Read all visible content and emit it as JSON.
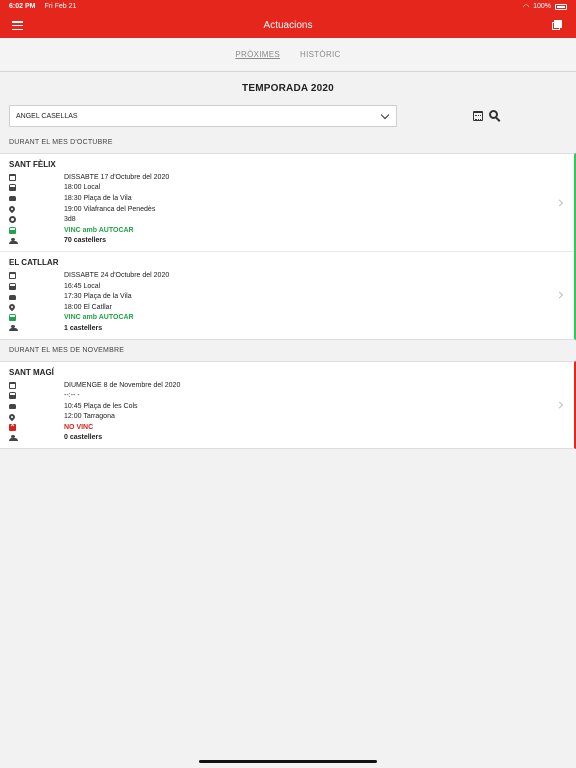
{
  "status_bar": {
    "time": "6:02 PM",
    "date": "Fri Feb 21",
    "battery": "100%"
  },
  "header": {
    "title": "Actuacions"
  },
  "tabs": [
    {
      "label": "PRÒXIMES",
      "active": true
    },
    {
      "label": "HISTÒRIC",
      "active": false
    }
  ],
  "season_title": "TEMPORADA 2020",
  "person_select": {
    "value": "ANGEL CASELLAS"
  },
  "colors": {
    "brand": "#e5261c",
    "attending": "#21a34a",
    "not_attending": "#d8221b"
  },
  "months": [
    {
      "label": "DURANT EL MES D'OCTUBRE",
      "status_color": "green",
      "events": [
        {
          "name": "SANT FÈLIX",
          "rows": [
            {
              "icon": "calendar-icon",
              "text": "DISSABTE 17 d'Octubre del 2020",
              "style": ""
            },
            {
              "icon": "bus-icon",
              "text": "18:00 Local",
              "style": ""
            },
            {
              "icon": "car-icon",
              "text": "18:30 Plaça de la Vila",
              "style": ""
            },
            {
              "icon": "map-pin-icon",
              "text": "19:00 Vilafranca del Penedès",
              "style": ""
            },
            {
              "icon": "castell-icon",
              "text": "3d8",
              "style": ""
            },
            {
              "icon": "bus-green-icon",
              "text": "VINC amb AUTOCAR",
              "style": "ok"
            },
            {
              "icon": "users-icon",
              "text": "70 castellers",
              "style": "bold"
            }
          ]
        },
        {
          "name": "EL CATLLAR",
          "rows": [
            {
              "icon": "calendar-icon",
              "text": "DISSABTE 24 d'Octubre del 2020",
              "style": ""
            },
            {
              "icon": "bus-icon",
              "text": "16:45 Local",
              "style": ""
            },
            {
              "icon": "car-icon",
              "text": "17:30 Plaça de la Vila",
              "style": ""
            },
            {
              "icon": "map-pin-icon",
              "text": "18:00 El Catllar",
              "style": ""
            },
            {
              "icon": "bus-green-icon",
              "text": "VINC amb AUTOCAR",
              "style": "ok"
            },
            {
              "icon": "users-icon",
              "text": "1 castellers",
              "style": "bold"
            }
          ]
        }
      ]
    },
    {
      "label": "DURANT EL MES DE NOVEMBRE",
      "status_color": "red",
      "events": [
        {
          "name": "SANT MAGÍ",
          "rows": [
            {
              "icon": "calendar-icon",
              "text": "DIUMENGE 8 de Novembre del 2020",
              "style": ""
            },
            {
              "icon": "bus-icon",
              "text": "--:-- -",
              "style": ""
            },
            {
              "icon": "car-icon",
              "text": "10:45 Plaça de les Cols",
              "style": ""
            },
            {
              "icon": "map-pin-icon",
              "text": "12:00 Tarragona",
              "style": ""
            },
            {
              "icon": "calendar-x-icon",
              "text": "NO VINC",
              "style": "no"
            },
            {
              "icon": "users-icon",
              "text": "0 castellers",
              "style": "bold"
            }
          ]
        }
      ]
    }
  ]
}
